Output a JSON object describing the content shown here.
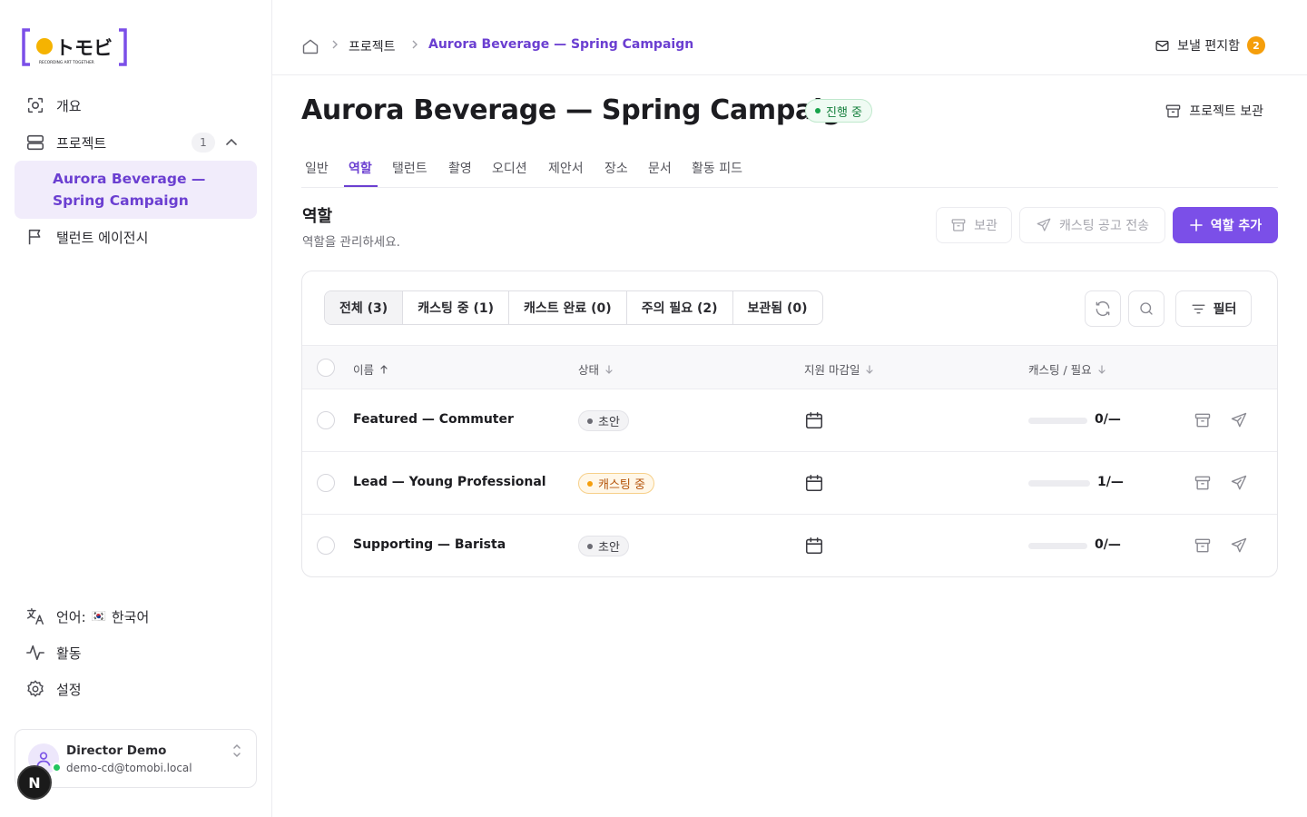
{
  "logo": {
    "text": "トモビ",
    "tagline": "RECORDING ART TOGETHER"
  },
  "sidebar": {
    "items": [
      {
        "label": "개요",
        "icon": "overview-icon"
      },
      {
        "label": "프로젝트",
        "icon": "projects-icon",
        "badge": "1"
      },
      {
        "label": "탤런트 에이전시",
        "icon": "flag-icon"
      }
    ],
    "active_project": "Aurora Beverage — Spring Campaign",
    "language_label": "언어:",
    "language_flag": "🇰🇷",
    "language_value": "한국어",
    "activity": "활동",
    "settings": "설정"
  },
  "user": {
    "name": "Director Demo",
    "email": "demo-cd@tomobi.local",
    "initial": "N"
  },
  "breadcrumb": {
    "projects": "프로젝트",
    "current": "Aurora Beverage — Spring Campaign"
  },
  "outbox": {
    "label": "보낼 편지함",
    "count": "2"
  },
  "header": {
    "title": "Aurora Beverage — Spring Campaign",
    "status": "진행 중",
    "archive_label": "프로젝트 보관"
  },
  "tabs": [
    "일반",
    "역할",
    "탤런트",
    "촬영",
    "오디션",
    "제안서",
    "장소",
    "문서",
    "활동 피드"
  ],
  "active_tab": "역할",
  "section": {
    "title": "역할",
    "description": "역할을 관리하세요."
  },
  "actions": {
    "archive": "보관",
    "send_notice": "캐스팅 공고 전송",
    "add_role": "역할 추가"
  },
  "segments": [
    "전체 (3)",
    "캐스팅 중 (1)",
    "캐스트 완료 (0)",
    "주의 필요 (2)",
    "보관됨 (0)"
  ],
  "filter_label": "필터",
  "table": {
    "columns": [
      "이름",
      "상태",
      "지원 마감일",
      "캐스팅 / 필요"
    ],
    "rows": [
      {
        "name": "Featured — Commuter",
        "status": "초안",
        "status_kind": "draft",
        "ratio": "0/—",
        "progress": 0
      },
      {
        "name": "Lead — Young Professional",
        "status": "캐스팅 중",
        "status_kind": "casting",
        "ratio": "1/—",
        "progress": 0
      },
      {
        "name": "Supporting — Barista",
        "status": "초안",
        "status_kind": "draft",
        "ratio": "0/—",
        "progress": 0
      }
    ]
  },
  "colors": {
    "accent": "#7b4fe8",
    "active_text": "#6b3fd1",
    "success": "#15803d",
    "warning": "#f59e0b"
  }
}
